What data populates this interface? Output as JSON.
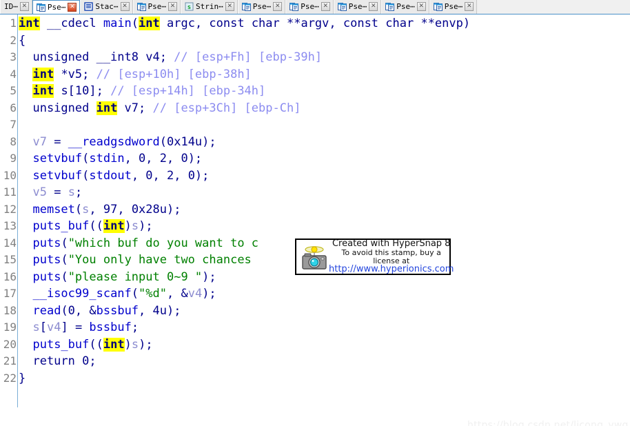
{
  "tabs": [
    {
      "label": "ID⋯",
      "icon": "ida-icon",
      "active": false,
      "close_label": "✕",
      "has_icon": false
    },
    {
      "label": "Pse⋯",
      "icon": "pseudocode-icon",
      "active": true,
      "close_label": "✕",
      "has_icon": true
    },
    {
      "label": "Stac⋯",
      "icon": "stack-icon",
      "active": false,
      "close_label": "✕",
      "has_icon": true
    },
    {
      "label": "Pse⋯",
      "icon": "pseudocode-icon",
      "active": false,
      "close_label": "✕",
      "has_icon": true
    },
    {
      "label": "Strin⋯",
      "icon": "strings-icon",
      "active": false,
      "close_label": "✕",
      "has_icon": true
    },
    {
      "label": "Pse⋯",
      "icon": "pseudocode-icon",
      "active": false,
      "close_label": "✕",
      "has_icon": true
    },
    {
      "label": "Pse⋯",
      "icon": "pseudocode-icon",
      "active": false,
      "close_label": "✕",
      "has_icon": true
    },
    {
      "label": "Pse⋯",
      "icon": "pseudocode-icon",
      "active": false,
      "close_label": "✕",
      "has_icon": true
    },
    {
      "label": "Pse⋯",
      "icon": "pseudocode-icon",
      "active": false,
      "close_label": "✕",
      "has_icon": true
    },
    {
      "label": "Pse⋯",
      "icon": "pseudocode-icon",
      "active": false,
      "close_label": "✕",
      "has_icon": true
    }
  ],
  "colors": {
    "keyword_highlight": "#ffff00",
    "keyword_text": "#00007a",
    "function": "#0000cd",
    "variable": "#8c8cd0",
    "string": "#008000",
    "comment": "#8c8cf0",
    "plain": "#00008b",
    "lineno": "#808080",
    "gutter_rule": "#7aaed6",
    "tabbar_bg": "#f0f0f0",
    "active_tab_border": "#4a90c8",
    "active_tab_close": "#d4431c",
    "csdn_watermark": "#f0f0f0"
  },
  "code": {
    "lines": [
      {
        "n": "1",
        "tokens": [
          {
            "t": "int",
            "c": "k"
          },
          {
            "t": " __cdecl ",
            "c": "plain"
          },
          {
            "t": "main",
            "c": "fn"
          },
          {
            "t": "(",
            "c": "plain"
          },
          {
            "t": "int",
            "c": "k"
          },
          {
            "t": " argc, const char **argv, const char **envp)",
            "c": "plain"
          }
        ]
      },
      {
        "n": "2",
        "tokens": [
          {
            "t": "{",
            "c": "plain"
          }
        ]
      },
      {
        "n": "3",
        "tokens": [
          {
            "t": "  unsigned __int8 v4; ",
            "c": "plain"
          },
          {
            "t": "// [esp+Fh] [ebp-39h]",
            "c": "cmt"
          }
        ]
      },
      {
        "n": "4",
        "tokens": [
          {
            "t": "  ",
            "c": "plain"
          },
          {
            "t": "int",
            "c": "k"
          },
          {
            "t": " *v5; ",
            "c": "plain"
          },
          {
            "t": "// [esp+10h] [ebp-38h]",
            "c": "cmt"
          }
        ]
      },
      {
        "n": "5",
        "tokens": [
          {
            "t": "  ",
            "c": "plain"
          },
          {
            "t": "int",
            "c": "k"
          },
          {
            "t": " s[10]; ",
            "c": "plain"
          },
          {
            "t": "// [esp+14h] [ebp-34h]",
            "c": "cmt"
          }
        ]
      },
      {
        "n": "6",
        "tokens": [
          {
            "t": "  unsigned ",
            "c": "plain"
          },
          {
            "t": "int",
            "c": "k"
          },
          {
            "t": " v7; ",
            "c": "plain"
          },
          {
            "t": "// [esp+3Ch] [ebp-Ch]",
            "c": "cmt"
          }
        ]
      },
      {
        "n": "7",
        "tokens": []
      },
      {
        "n": "8",
        "tokens": [
          {
            "t": "  ",
            "c": "plain"
          },
          {
            "t": "v7",
            "c": "var"
          },
          {
            "t": " = ",
            "c": "plain"
          },
          {
            "t": "__readgsdword",
            "c": "fn"
          },
          {
            "t": "(0x14u);",
            "c": "plain"
          }
        ]
      },
      {
        "n": "9",
        "tokens": [
          {
            "t": "  ",
            "c": "plain"
          },
          {
            "t": "setvbuf",
            "c": "fn"
          },
          {
            "t": "(",
            "c": "plain"
          },
          {
            "t": "stdin",
            "c": "fn"
          },
          {
            "t": ", 0, 2, 0);",
            "c": "plain"
          }
        ]
      },
      {
        "n": "10",
        "tokens": [
          {
            "t": "  ",
            "c": "plain"
          },
          {
            "t": "setvbuf",
            "c": "fn"
          },
          {
            "t": "(",
            "c": "plain"
          },
          {
            "t": "stdout",
            "c": "fn"
          },
          {
            "t": ", 0, 2, 0);",
            "c": "plain"
          }
        ]
      },
      {
        "n": "11",
        "tokens": [
          {
            "t": "  ",
            "c": "plain"
          },
          {
            "t": "v5",
            "c": "var"
          },
          {
            "t": " = ",
            "c": "plain"
          },
          {
            "t": "s",
            "c": "var"
          },
          {
            "t": ";",
            "c": "plain"
          }
        ]
      },
      {
        "n": "12",
        "tokens": [
          {
            "t": "  ",
            "c": "plain"
          },
          {
            "t": "memset",
            "c": "fn"
          },
          {
            "t": "(",
            "c": "plain"
          },
          {
            "t": "s",
            "c": "var"
          },
          {
            "t": ", 97, 0x28u);",
            "c": "plain"
          }
        ]
      },
      {
        "n": "13",
        "tokens": [
          {
            "t": "  ",
            "c": "plain"
          },
          {
            "t": "puts_buf",
            "c": "fn"
          },
          {
            "t": "((",
            "c": "plain"
          },
          {
            "t": "int",
            "c": "k"
          },
          {
            "t": ")",
            "c": "plain"
          },
          {
            "t": "s",
            "c": "var"
          },
          {
            "t": ");",
            "c": "plain"
          }
        ]
      },
      {
        "n": "14",
        "tokens": [
          {
            "t": "  ",
            "c": "plain"
          },
          {
            "t": "puts",
            "c": "fn"
          },
          {
            "t": "(",
            "c": "plain"
          },
          {
            "t": "\"which buf do you want to c",
            "c": "str"
          }
        ]
      },
      {
        "n": "15",
        "tokens": [
          {
            "t": "  ",
            "c": "plain"
          },
          {
            "t": "puts",
            "c": "fn"
          },
          {
            "t": "(",
            "c": "plain"
          },
          {
            "t": "\"You only have two chances ",
            "c": "str"
          }
        ]
      },
      {
        "n": "16",
        "tokens": [
          {
            "t": "  ",
            "c": "plain"
          },
          {
            "t": "puts",
            "c": "fn"
          },
          {
            "t": "(",
            "c": "plain"
          },
          {
            "t": "\"please input 0~9 \"",
            "c": "str"
          },
          {
            "t": ");",
            "c": "plain"
          }
        ]
      },
      {
        "n": "17",
        "tokens": [
          {
            "t": "  ",
            "c": "plain"
          },
          {
            "t": "__isoc99_scanf",
            "c": "fn"
          },
          {
            "t": "(",
            "c": "plain"
          },
          {
            "t": "\"%d\"",
            "c": "str"
          },
          {
            "t": ", &",
            "c": "plain"
          },
          {
            "t": "v4",
            "c": "var"
          },
          {
            "t": ");",
            "c": "plain"
          }
        ]
      },
      {
        "n": "18",
        "tokens": [
          {
            "t": "  ",
            "c": "plain"
          },
          {
            "t": "read",
            "c": "fn"
          },
          {
            "t": "(0, &",
            "c": "plain"
          },
          {
            "t": "bssbuf",
            "c": "fn"
          },
          {
            "t": ", 4u);",
            "c": "plain"
          }
        ]
      },
      {
        "n": "19",
        "tokens": [
          {
            "t": "  ",
            "c": "plain"
          },
          {
            "t": "s",
            "c": "var"
          },
          {
            "t": "[",
            "c": "plain"
          },
          {
            "t": "v4",
            "c": "var"
          },
          {
            "t": "] = ",
            "c": "plain"
          },
          {
            "t": "bssbuf",
            "c": "fn"
          },
          {
            "t": ";",
            "c": "plain"
          }
        ]
      },
      {
        "n": "20",
        "tokens": [
          {
            "t": "  ",
            "c": "plain"
          },
          {
            "t": "puts_buf",
            "c": "fn"
          },
          {
            "t": "((",
            "c": "plain"
          },
          {
            "t": "int",
            "c": "k"
          },
          {
            "t": ")",
            "c": "plain"
          },
          {
            "t": "s",
            "c": "var"
          },
          {
            "t": ");",
            "c": "plain"
          }
        ]
      },
      {
        "n": "21",
        "tokens": [
          {
            "t": "  return 0;",
            "c": "plain"
          }
        ]
      },
      {
        "n": "22",
        "tokens": [
          {
            "t": "}",
            "c": "plain"
          }
        ]
      }
    ]
  },
  "hypersnap_stamp": {
    "line1": "Created with HyperSnap 8",
    "line2": "To avoid this stamp, buy a license at",
    "line3": "http://www.hyperionics.com"
  },
  "csdn_watermark": {
    "text": "https://blog.csdn.net/licong_ywq"
  }
}
